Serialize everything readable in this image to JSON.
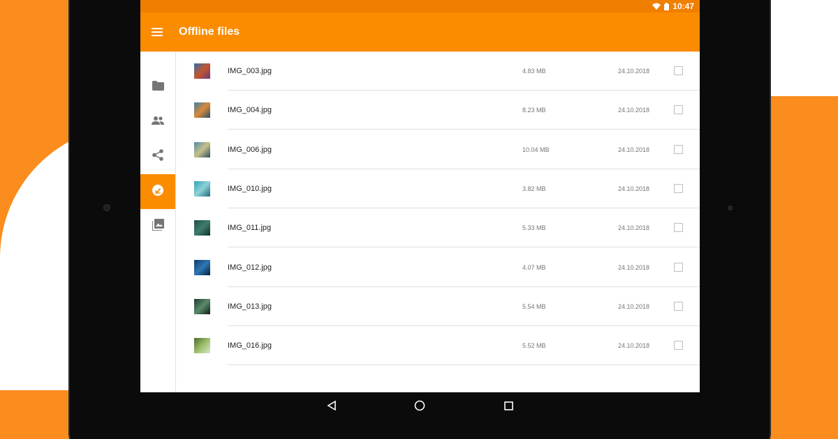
{
  "status_bar": {
    "time": "10:47"
  },
  "app_bar": {
    "title": "Offline files"
  },
  "side_nav": {
    "items": [
      {
        "name": "folder-icon",
        "active": false
      },
      {
        "name": "people-icon",
        "active": false
      },
      {
        "name": "share-icon",
        "active": false
      },
      {
        "name": "offline-icon",
        "active": true
      },
      {
        "name": "photo-library-icon",
        "active": false
      }
    ]
  },
  "files": [
    {
      "name": "IMG_003.jpg",
      "size": "4.83 MB",
      "date": "24.10.2018",
      "thumb_colors": [
        "#2f6fa8",
        "#c4552f",
        "#6c3a7a"
      ]
    },
    {
      "name": "IMG_004.jpg",
      "size": "8.23 MB",
      "date": "24.10.2018",
      "thumb_colors": [
        "#3d7fa6",
        "#d98a3a",
        "#2a4f66"
      ]
    },
    {
      "name": "IMG_006.jpg",
      "size": "10.04 MB",
      "date": "24.10.2018",
      "thumb_colors": [
        "#4f8aa8",
        "#c9c08a",
        "#2d4e5e"
      ]
    },
    {
      "name": "IMG_010.jpg",
      "size": "3.82 MB",
      "date": "24.10.2018",
      "thumb_colors": [
        "#2ea3b8",
        "#8fd1d8",
        "#1c6c7c"
      ]
    },
    {
      "name": "IMG_011.jpg",
      "size": "5.33 MB",
      "date": "24.10.2018",
      "thumb_colors": [
        "#1e4f4a",
        "#3e7d6e",
        "#0f2c2a"
      ]
    },
    {
      "name": "IMG_012.jpg",
      "size": "4.07 MB",
      "date": "24.10.2018",
      "thumb_colors": [
        "#0d3d6b",
        "#2d77b5",
        "#06203a"
      ]
    },
    {
      "name": "IMG_013.jpg",
      "size": "5.54 MB",
      "date": "24.10.2018",
      "thumb_colors": [
        "#1f3d34",
        "#5a8a6a",
        "#0e1e1a"
      ]
    },
    {
      "name": "IMG_016.jpg",
      "size": "5.52 MB",
      "date": "24.10.2018",
      "thumb_colors": [
        "#4a6b2a",
        "#9bbf6a",
        "#d8e6c8"
      ]
    }
  ],
  "colors": {
    "accent": "#fb8c00",
    "status_bar": "#f07f00",
    "background_orange": "#fb8c1e"
  }
}
